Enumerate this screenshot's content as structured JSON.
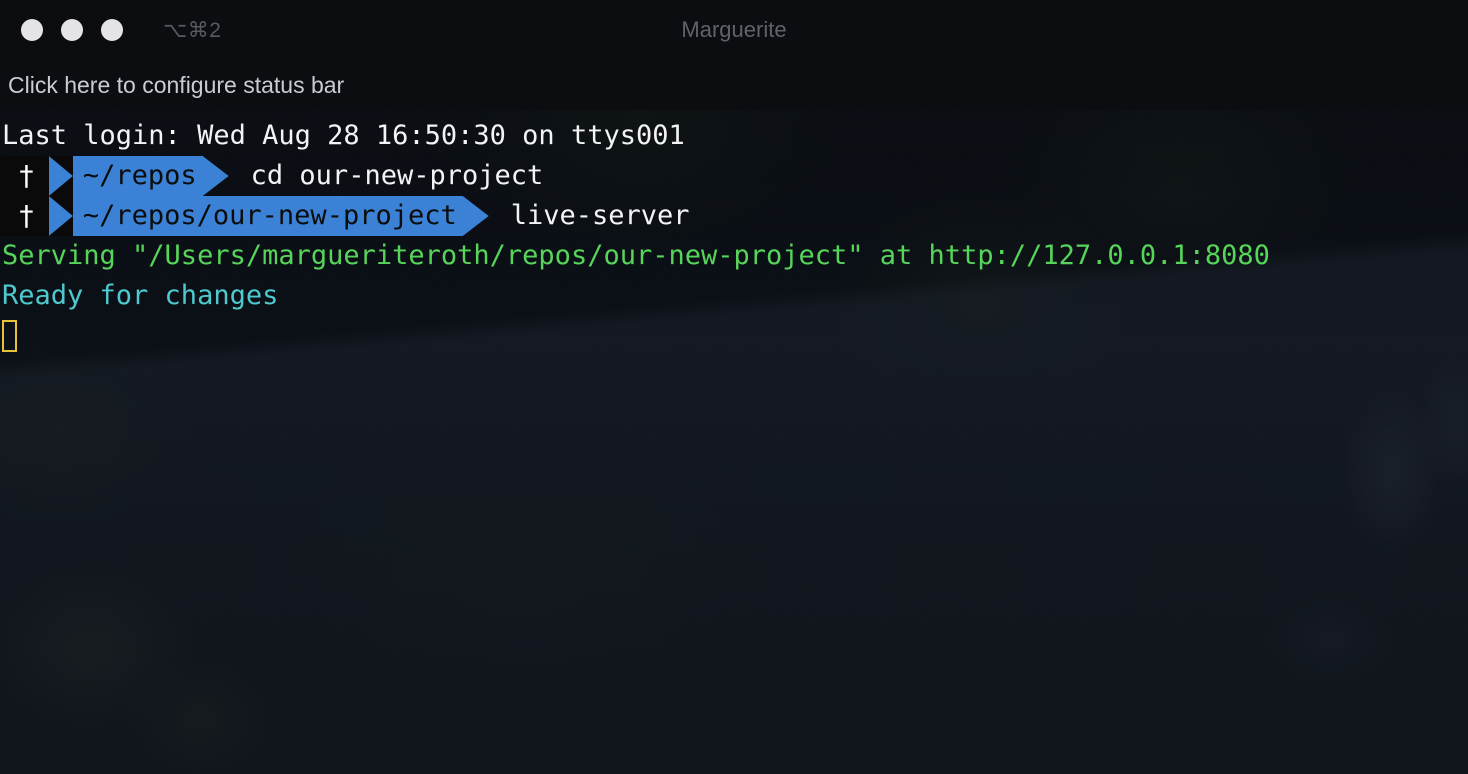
{
  "window": {
    "title": "Marguerite",
    "shortcut": "⌥⌘2",
    "traffic_lights": [
      {
        "name": "close",
        "color": "#e4e4e6"
      },
      {
        "name": "minimize",
        "color": "#e4e4e6"
      },
      {
        "name": "zoom",
        "color": "#e4e4e6"
      }
    ]
  },
  "status_bar": {
    "text": "Click here to configure status bar"
  },
  "terminal": {
    "login_line": "Last login: Wed Aug 28 16:50:30 on ttys001",
    "prompts": [
      {
        "icon": "†",
        "path": "~/repos",
        "command": "cd our-new-project"
      },
      {
        "icon": "†",
        "path": "~/repos/our-new-project",
        "command": "live-server"
      }
    ],
    "output": [
      {
        "text": "Serving \"/Users/margueriteroth/repos/our-new-project\" at http://127.0.0.1:8080",
        "color": "#57d45a"
      },
      {
        "text": "Ready for changes",
        "color": "#4ec9cd"
      }
    ],
    "cursor": {
      "style": "hollow-block",
      "color": "#e8c13c"
    }
  },
  "colors": {
    "powerline_blue": "#3b82d6",
    "powerline_dark": "#0a0a0a",
    "prompt_text": "#0c0c0c",
    "foreground": "#f2f3f4",
    "title_bar": "#0b0d11"
  }
}
